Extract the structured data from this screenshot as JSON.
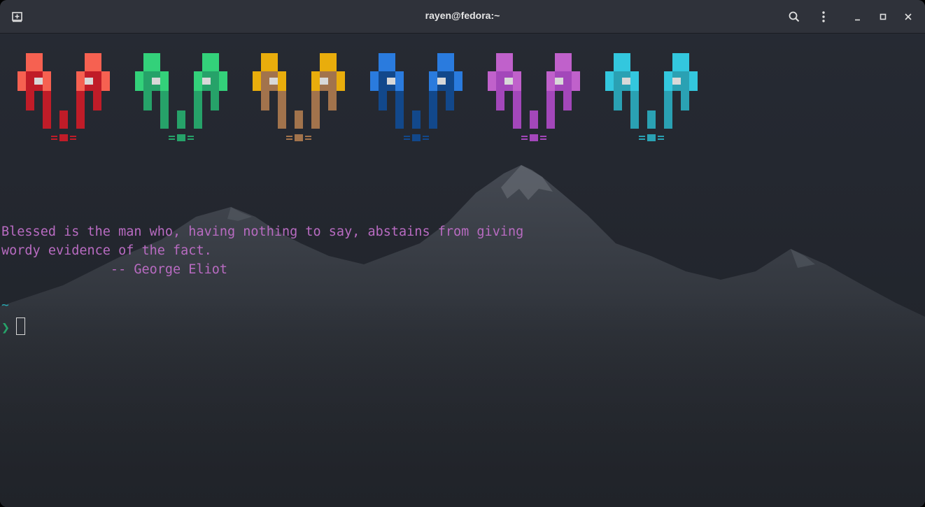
{
  "window": {
    "title": "rayen@fedora:~",
    "icons": {
      "new_tab": "new-tab-icon",
      "search": "search-icon",
      "menu": "kebab-menu-icon",
      "minimize": "minimize-icon",
      "maximize": "maximize-icon",
      "close": "close-icon"
    }
  },
  "terminal": {
    "quote_line_1": "Blessed is the man who, having nothing to say, abstains from giving",
    "quote_line_2": "wordy evidence of the fact.",
    "quote_attribution": "              -- George Eliot",
    "cwd": "~",
    "prompt_symbol": "❯",
    "colors": {
      "background": "#22252d",
      "quote": "#b86bc1",
      "cwd": "#27a8b2",
      "prompt": "#26a269"
    }
  },
  "invaders": [
    {
      "name": "red",
      "light": "#f66151",
      "dark": "#c01c28"
    },
    {
      "name": "green",
      "light": "#33d17a",
      "dark": "#26a269"
    },
    {
      "name": "yellow",
      "light": "#e9ad0c",
      "dark": "#a2734c"
    },
    {
      "name": "blue",
      "light": "#2a7bde",
      "dark": "#12488b"
    },
    {
      "name": "purple",
      "light": "#c061cb",
      "dark": "#a347ba"
    },
    {
      "name": "cyan",
      "light": "#33c7de",
      "dark": "#2aa1b3"
    }
  ]
}
